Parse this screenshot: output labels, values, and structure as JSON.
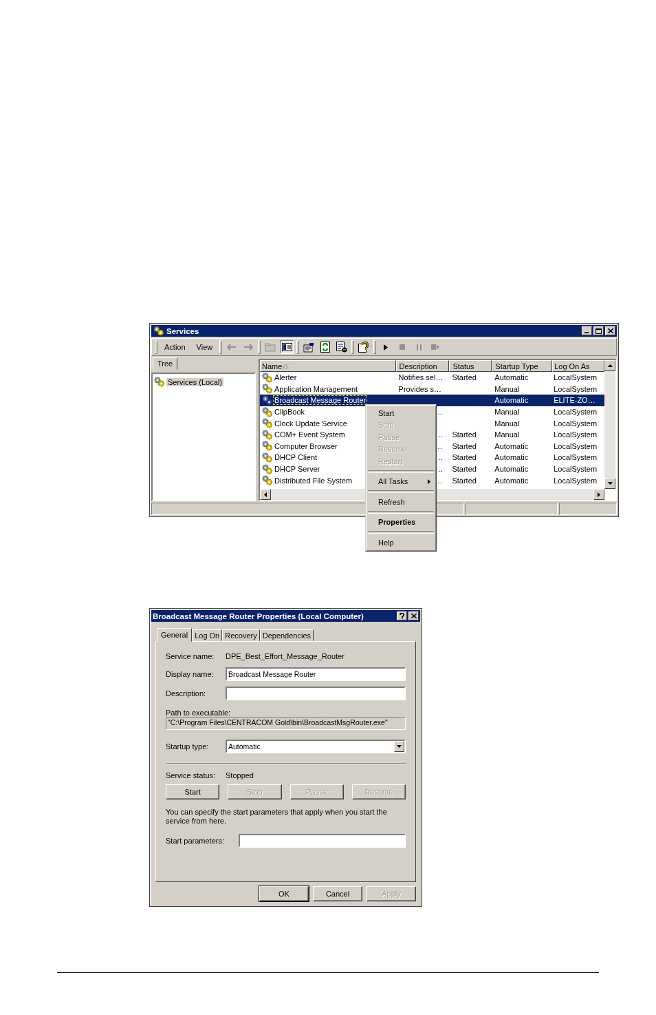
{
  "services_window": {
    "title": "Services",
    "menu": [
      "Action",
      "View"
    ],
    "tree_tab": "Tree",
    "tree_items": [
      {
        "label": "Services (Local)",
        "selected": true
      }
    ],
    "columns": [
      "Name",
      "Description",
      "Status",
      "Startup Type",
      "Log On As"
    ],
    "rows": [
      {
        "name": "Alerter",
        "description": "Notifies sel…",
        "status": "Started",
        "startup_type": "Automatic",
        "log_on_as": "LocalSystem",
        "selected": false
      },
      {
        "name": "Application Management",
        "description": "Provides s…",
        "status": "",
        "startup_type": "Manual",
        "log_on_as": "LocalSystem",
        "selected": false
      },
      {
        "name": "Broadcast Message Router",
        "description": "",
        "status": "",
        "startup_type": "Automatic",
        "log_on_as": "ELITE-ZO…",
        "selected": true
      },
      {
        "name": "ClipBook",
        "description": "…",
        "status": "",
        "startup_type": "Manual",
        "log_on_as": "LocalSystem",
        "selected": false
      },
      {
        "name": "Clock Update Service",
        "description": "",
        "status": "",
        "startup_type": "Manual",
        "log_on_as": "LocalSystem",
        "selected": false
      },
      {
        "name": "COM+ Event System",
        "description": "..",
        "status": "Started",
        "startup_type": "Manual",
        "log_on_as": "LocalSystem",
        "selected": false
      },
      {
        "name": "Computer Browser",
        "description": "…",
        "status": "Started",
        "startup_type": "Automatic",
        "log_on_as": "LocalSystem",
        "selected": false
      },
      {
        "name": "DHCP Client",
        "description": "..",
        "status": "Started",
        "startup_type": "Automatic",
        "log_on_as": "LocalSystem",
        "selected": false
      },
      {
        "name": "DHCP Server",
        "description": "..",
        "status": "Started",
        "startup_type": "Automatic",
        "log_on_as": "LocalSystem",
        "selected": false
      },
      {
        "name": "Distributed File System",
        "description": "…",
        "status": "Started",
        "startup_type": "Automatic",
        "log_on_as": "LocalSystem",
        "selected": false
      }
    ]
  },
  "context_menu": {
    "items": [
      {
        "kind": "item",
        "label": "Start",
        "disabled": false,
        "default": false
      },
      {
        "kind": "item",
        "label": "Stop",
        "disabled": true,
        "default": false
      },
      {
        "kind": "item",
        "label": "Pause",
        "disabled": true,
        "default": false
      },
      {
        "kind": "item",
        "label": "Resume",
        "disabled": true,
        "default": false
      },
      {
        "kind": "item",
        "label": "Restart",
        "disabled": true,
        "default": false
      },
      {
        "kind": "separator"
      },
      {
        "kind": "submenu",
        "label": "All Tasks",
        "disabled": false,
        "default": false
      },
      {
        "kind": "separator"
      },
      {
        "kind": "item",
        "label": "Refresh",
        "disabled": false,
        "default": false
      },
      {
        "kind": "separator"
      },
      {
        "kind": "item",
        "label": "Properties",
        "disabled": false,
        "default": true
      },
      {
        "kind": "separator"
      },
      {
        "kind": "item",
        "label": "Help",
        "disabled": false,
        "default": false
      }
    ]
  },
  "dialog": {
    "title": "Broadcast Message Router Properties (Local Computer)",
    "tabs": [
      {
        "label": "General",
        "selected": true
      },
      {
        "label": "Log On",
        "selected": false
      },
      {
        "label": "Recovery",
        "selected": false
      },
      {
        "label": "Dependencies",
        "selected": false
      }
    ],
    "service_name_label": "Service name:",
    "service_name": "DPE_Best_Effort_Message_Router",
    "display_name_label": "Display name:",
    "display_name": "Broadcast Message Router",
    "description_label": "Description:",
    "path_label": "Path to executable:",
    "path": "\"C:\\Program Files\\CENTRACOM Gold\\bin\\BroadcastMsgRouter.exe\"",
    "startup_type_label": "Startup type:",
    "startup_type": "Automatic",
    "service_status_label": "Service status:",
    "service_status": "Stopped",
    "control_buttons": [
      {
        "label": "Start",
        "disabled": false
      },
      {
        "label": "Stop",
        "disabled": true
      },
      {
        "label": "Pause",
        "disabled": true
      },
      {
        "label": "Resume",
        "disabled": true
      }
    ],
    "hint": "You can specify the start parameters that apply when you start the service from here.",
    "start_parameters_label": "Start parameters:",
    "buttons": [
      {
        "label": "OK",
        "disabled": false,
        "default": true
      },
      {
        "label": "Cancel",
        "disabled": false,
        "default": false
      },
      {
        "label": "Apply",
        "disabled": true,
        "default": false
      }
    ]
  }
}
